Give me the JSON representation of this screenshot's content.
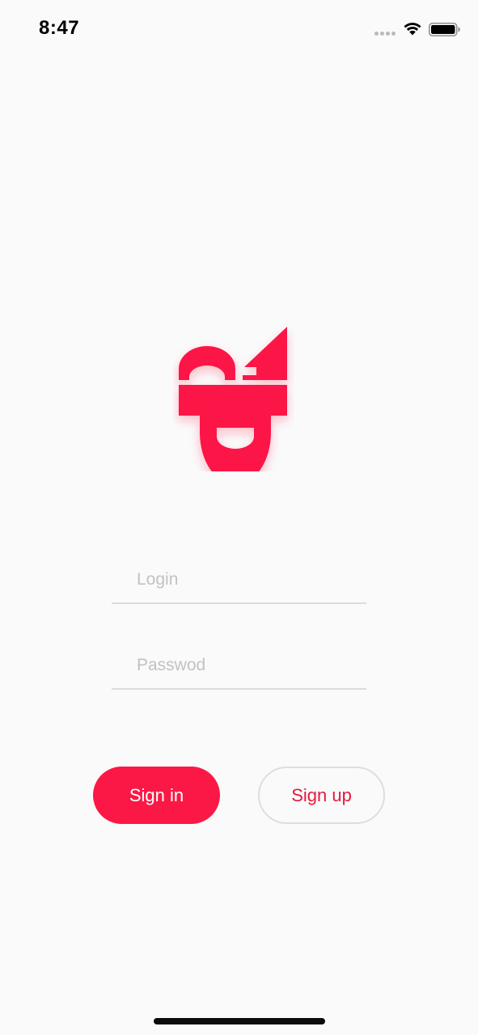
{
  "status_bar": {
    "time": "8:47",
    "icons": [
      "cellular-signal-icon",
      "wifi-icon",
      "battery-icon"
    ]
  },
  "logo": {
    "name": "app-logo",
    "color": "#fb1846"
  },
  "form": {
    "login_placeholder": "Login",
    "password_placeholder": "Passwod"
  },
  "buttons": {
    "sign_in_label": "Sign in",
    "sign_up_label": "Sign up"
  },
  "colors": {
    "accent": "#fb1846",
    "background": "#fafafa",
    "divider": "#dcdcdc",
    "placeholder": "#c2c2c2"
  }
}
